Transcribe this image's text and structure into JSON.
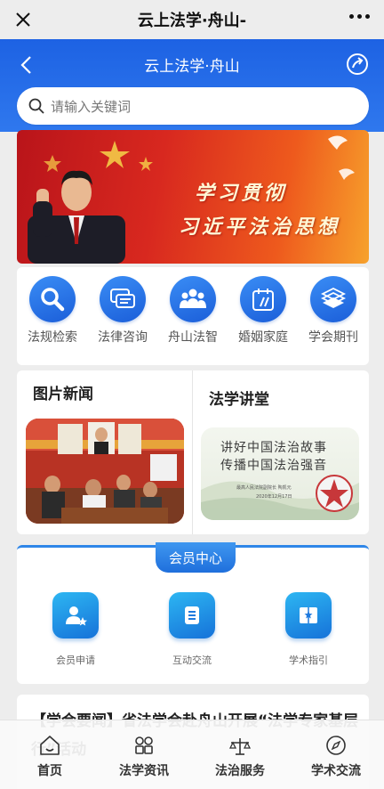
{
  "wechat_bar": {
    "title": "云上法学·舟山-"
  },
  "header": {
    "title": "云上法学·舟山"
  },
  "search": {
    "placeholder": "请输入关键词"
  },
  "banner": {
    "line1": "学习贯彻",
    "line2": "习近平法治思想"
  },
  "quick_links": [
    {
      "label": "法规检索",
      "icon": "search-icon"
    },
    {
      "label": "法律咨询",
      "icon": "chat-icon"
    },
    {
      "label": "舟山法智",
      "icon": "group-icon"
    },
    {
      "label": "婚姻家庭",
      "icon": "calendar-icon"
    },
    {
      "label": "学会期刊",
      "icon": "journal-icon"
    }
  ],
  "news": {
    "photo_news_title": "图片新闻",
    "lecture_title": "法学讲堂",
    "lecture_image": {
      "line1": "讲好中国法治故事",
      "line2": "传播中国法治强音",
      "byline": "最高人民法院副院长  陶凯元",
      "date": "2020年12月17日"
    }
  },
  "member_center": {
    "title": "会员中心",
    "items": [
      {
        "label": "会员申请",
        "icon": "user-star-icon"
      },
      {
        "label": "互动交流",
        "icon": "document-icon"
      },
      {
        "label": "学术指引",
        "icon": "book-icon"
      }
    ]
  },
  "article": {
    "text": "【学会要闻】省法学会赴舟山开展“法学专家基层行”活动"
  },
  "bottom_nav": [
    {
      "label": "首页",
      "icon": "home-icon"
    },
    {
      "label": "法学资讯",
      "icon": "grid-icon"
    },
    {
      "label": "法治服务",
      "icon": "scales-icon"
    },
    {
      "label": "学术交流",
      "icon": "compass-icon"
    }
  ],
  "colors": {
    "primary_blue": "#1d62e3",
    "banner_red": "#d8281f"
  }
}
